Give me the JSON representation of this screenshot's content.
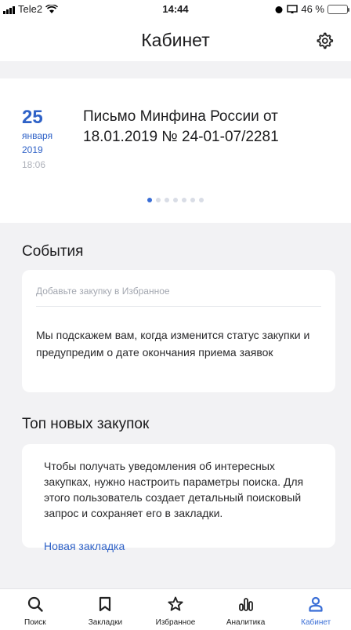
{
  "status_bar": {
    "carrier": "Tele2",
    "time": "14:44",
    "battery_percent": "46 %",
    "battery_level": 0.46,
    "battery_color": "#4cd964"
  },
  "header": {
    "title": "Кабинет",
    "settings_icon": "gear-icon"
  },
  "news": {
    "day": "25",
    "month": "января",
    "year": "2019",
    "time": "18:06",
    "headline": "Письмо Минфина России от 18.01.2019 № 24-01-07/2281",
    "pager": {
      "count": 7,
      "active_index": 0
    }
  },
  "events": {
    "title": "События",
    "hint": "Добавьте закупку в Избранное",
    "text": "Мы подскажем вам, когда изменится статус закупки и предупредим о дате окончания приема заявок"
  },
  "top_tenders": {
    "title": "Топ новых закупок",
    "text": "Чтобы получать уведомления об интересных закупках, нужно настроить параметры поиска. Для этого пользователь создает детальный поисковый запрос и сохраняет его в закладки.",
    "link": "Новая закладка"
  },
  "tabs": [
    {
      "label": "Поиск",
      "icon": "search-icon",
      "active": false
    },
    {
      "label": "Закладки",
      "icon": "bookmark-icon",
      "active": false
    },
    {
      "label": "Избранное",
      "icon": "star-icon",
      "active": false
    },
    {
      "label": "Аналитика",
      "icon": "chart-icon",
      "active": false
    },
    {
      "label": "Кабинет",
      "icon": "person-icon",
      "active": true
    }
  ],
  "colors": {
    "accent": "#3a6ed6",
    "link": "#2f62c7",
    "background": "#f2f2f4"
  }
}
